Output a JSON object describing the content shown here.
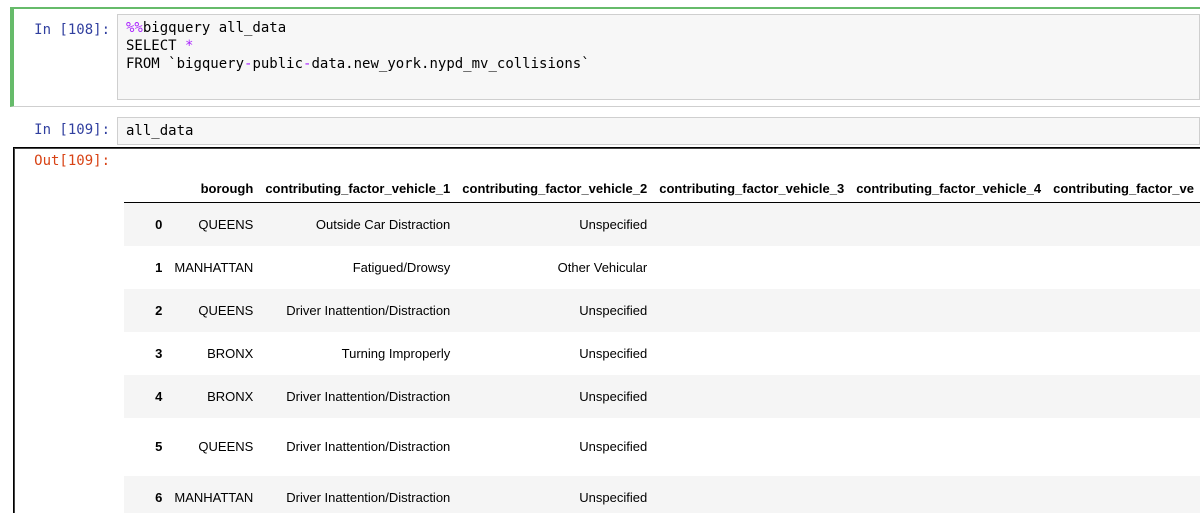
{
  "cell_in_1": {
    "prompt": "In [108]:",
    "magic_prefix": "%%",
    "magic_rest": "bigquery all_data",
    "line2_kw": "SELECT",
    "line2_star": "*",
    "line3_kw": "FROM",
    "line3_a": "`bigquery",
    "line3_b": "public",
    "line3_c": "data.new_york.nypd_mv_collisions`"
  },
  "cell_in_2": {
    "prompt": "In [109]:",
    "code": "all_data"
  },
  "cell_out_2": {
    "prompt": "Out[109]:"
  },
  "table": {
    "columns": [
      "",
      "borough",
      "contributing_factor_vehicle_1",
      "contributing_factor_vehicle_2",
      "contributing_factor_vehicle_3",
      "contributing_factor_vehicle_4",
      "contributing_factor_ve"
    ],
    "rows": [
      {
        "index": "0",
        "borough": "QUEENS",
        "cf1": "Outside Car Distraction",
        "cf2": "Unspecified"
      },
      {
        "index": "1",
        "borough": "MANHATTAN",
        "cf1": "Fatigued/Drowsy",
        "cf2": "Other Vehicular"
      },
      {
        "index": "2",
        "borough": "QUEENS",
        "cf1": "Driver Inattention/Distraction",
        "cf2": "Unspecified"
      },
      {
        "index": "3",
        "borough": "BRONX",
        "cf1": "Turning Improperly",
        "cf2": "Unspecified"
      },
      {
        "index": "4",
        "borough": "BRONX",
        "cf1": "Driver Inattention/Distraction",
        "cf2": "Unspecified"
      },
      {
        "index": "5",
        "borough": "QUEENS",
        "cf1": "Driver Inattention/Distraction",
        "cf2": "Unspecified"
      },
      {
        "index": "6",
        "borough": "MANHATTAN",
        "cf1": "Driver Inattention/Distraction",
        "cf2": "Unspecified"
      }
    ]
  },
  "colors": {
    "selected_cell_border": "#66bb6a",
    "in_prompt": "#303f9f",
    "out_prompt": "#d84315",
    "magic": "#aa22ff"
  }
}
